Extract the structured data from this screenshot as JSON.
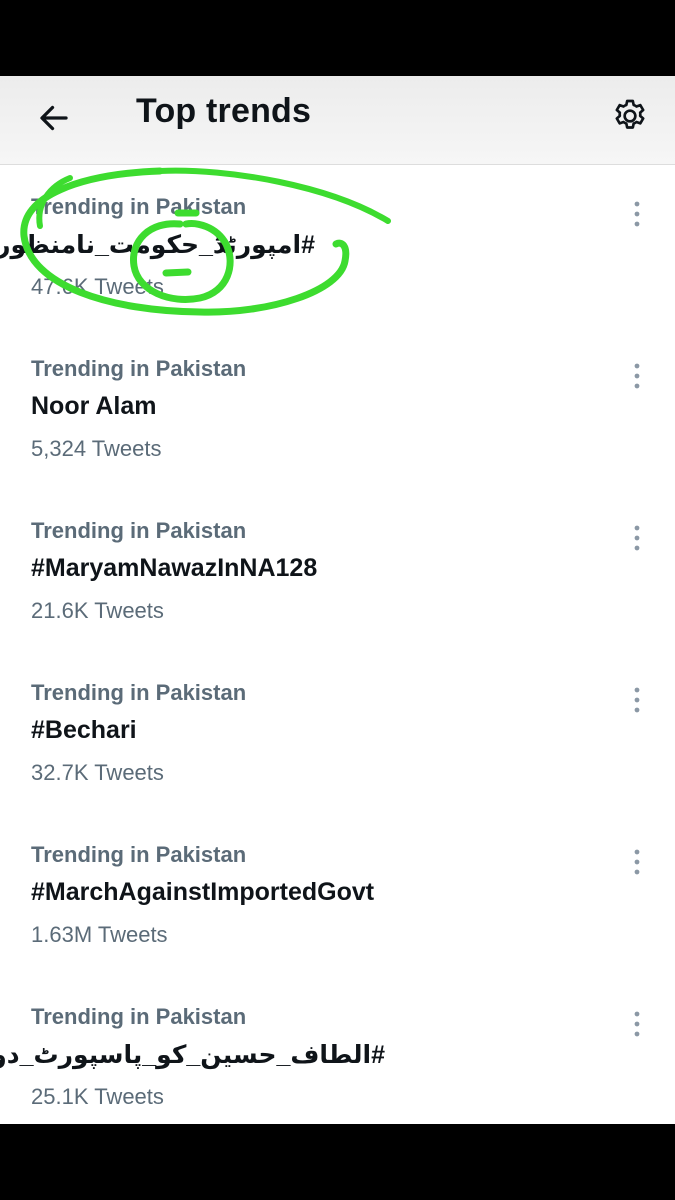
{
  "header": {
    "title": "Top trends",
    "back_icon": "arrow-left-icon",
    "settings_icon": "gear-icon"
  },
  "trends": [
    {
      "context": "Trending in Pakistan",
      "name": "#امپورٹڈ_حکومت_نامنظور",
      "count": "47.6K Tweets"
    },
    {
      "context": "Trending in Pakistan",
      "name": "Noor Alam",
      "count": "5,324 Tweets"
    },
    {
      "context": "Trending in Pakistan",
      "name": "#MaryamNawazInNA128",
      "count": "21.6K Tweets"
    },
    {
      "context": "Trending in Pakistan",
      "name": "#Bechari",
      "count": "32.7K Tweets"
    },
    {
      "context": "Trending in Pakistan",
      "name": "#MarchAgainstImportedGovt",
      "count": "1.63M Tweets"
    },
    {
      "context": "Trending in Pakistan",
      "name": "#الطاف_حسین_کو_پاسپورٹ_دو",
      "count": "25.1K Tweets"
    }
  ],
  "colors": {
    "accent_marker": "#3ddc2f",
    "text_primary": "#0f1419",
    "text_secondary": "#5b6b78"
  }
}
